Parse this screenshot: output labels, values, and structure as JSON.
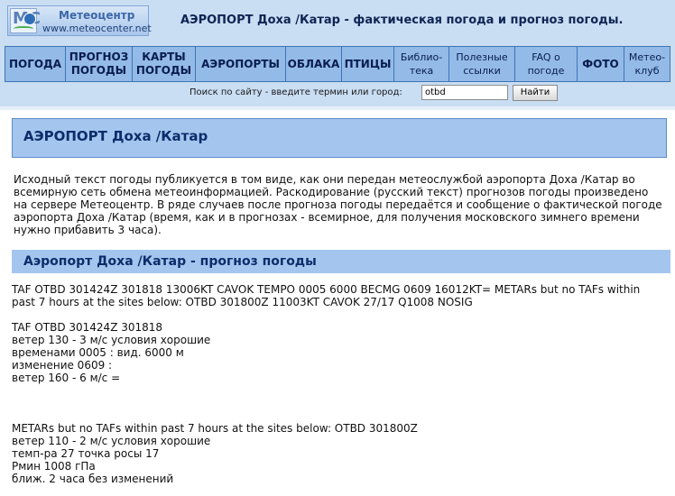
{
  "logo": {
    "name": "Метеоцентр",
    "url": "www.meteocenter.net",
    "mark_letters": "MC"
  },
  "headline": "АЭРОПОРТ Доха /Катар - фактическая погода и прогноз погоды.",
  "nav": [
    {
      "label": "ПОГОДА"
    },
    {
      "label": "ПРОГНОЗ ПОГОДЫ"
    },
    {
      "label": "КАРТЫ ПОГОДЫ"
    },
    {
      "label": "АЭРОПОРТЫ"
    },
    {
      "label": "ОБЛАКА"
    },
    {
      "label": "ПТИЦЫ"
    },
    {
      "label": "Библио-тека"
    },
    {
      "label": "Полезные ссылки"
    },
    {
      "label": "FAQ о погоде"
    },
    {
      "label": "ФОТО"
    },
    {
      "label": "Метео-клуб"
    }
  ],
  "search": {
    "label": "Поиск по сайту - введите термин или город:",
    "value": "otbd",
    "button": "Найти"
  },
  "main": {
    "title": "АЭРОПОРТ Доха /Катар",
    "intro": "Исходный текст погоды публикуется в том виде, как они передан метеослужбой аэропорта Доха /Катар во всемирную сеть обмена метеоинформацией. Раскодирование (русский текст) прогнозов погоды произведено на сервере Метеоцентр. В ряде случаев после прогноза погоды передаётся и сообщение о фактической погоде аэропорта Доха /Катар (время, как и в прогнозах - всемирное, для получения московского зимнего времени нужно прибавить 3 часа).",
    "section_title": "Аэропорт Доха /Катар - прогноз погоды",
    "raw_taf": "TAF OTBD 301424Z 301818 13006KT CAVOK TEMPO 0005 6000 BECMG 0609 16012KT= METARs but no TAFs within past 7 hours at the sites below: OTBD 301800Z 11003KT CAVOK 27/17 Q1008 NOSIG",
    "decoded_taf": "TAF OTBD 301424Z 301818\nветер 130 - 3 м/с условия хорошие\nвременами 0005 : вид. 6000 м\nизменение 0609 :\nветер 160 - 6 м/с =",
    "decoded_metar": "METARs but no TAFs within past 7 hours at the sites below: OTBD 301800Z\nветер 110 - 2 м/с условия хорошие\nтемп-ра 27 точка росы 17\nРмин 1008 гПа\nближ. 2 часа без изменений"
  }
}
